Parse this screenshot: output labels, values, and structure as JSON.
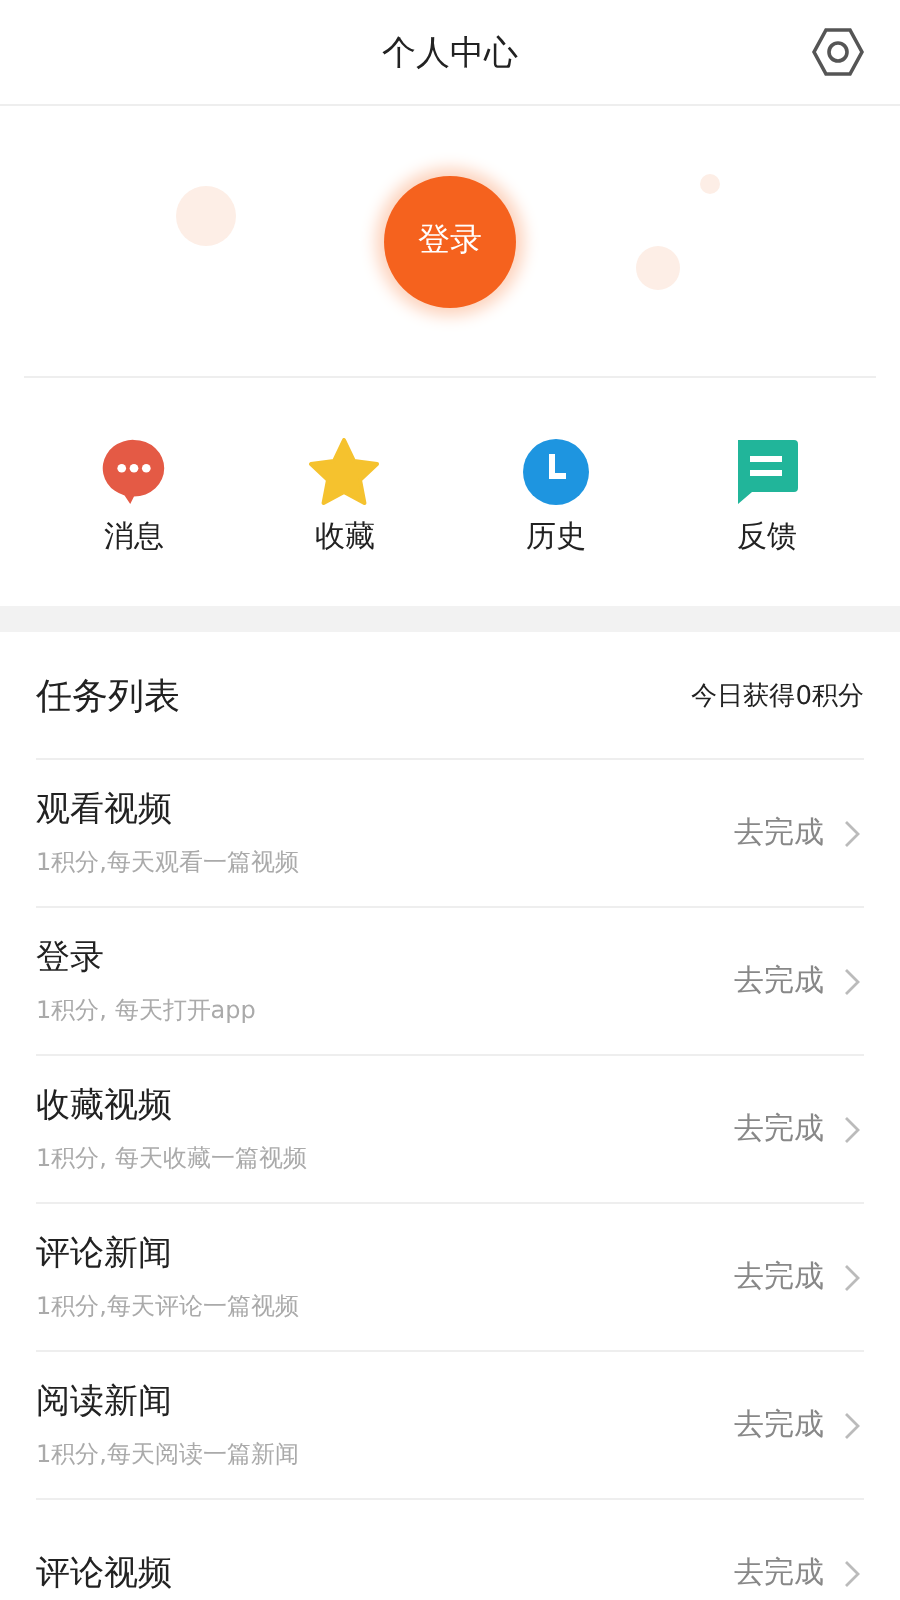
{
  "header": {
    "title": "个人中心"
  },
  "login": {
    "label": "登录"
  },
  "shortcuts": [
    {
      "kind": "message",
      "label": "消息"
    },
    {
      "kind": "star",
      "label": "收藏"
    },
    {
      "kind": "clock",
      "label": "历史"
    },
    {
      "kind": "feedback",
      "label": "反馈"
    }
  ],
  "tasks": {
    "title": "任务列表",
    "summary": "今日获得0积分",
    "rows": [
      {
        "title": "观看视频",
        "subtitle": "1积分,每天观看一篇视频",
        "action": "去完成"
      },
      {
        "title": "登录",
        "subtitle": "1积分, 每天打开app",
        "action": "去完成"
      },
      {
        "title": "收藏视频",
        "subtitle": "1积分, 每天收藏一篇视频",
        "action": "去完成"
      },
      {
        "title": "评论新闻",
        "subtitle": "1积分,每天评论一篇视频",
        "action": "去完成"
      },
      {
        "title": "阅读新闻",
        "subtitle": "1积分,每天阅读一篇新闻",
        "action": "去完成"
      },
      {
        "title": "评论视频",
        "action": "去完成"
      }
    ]
  }
}
